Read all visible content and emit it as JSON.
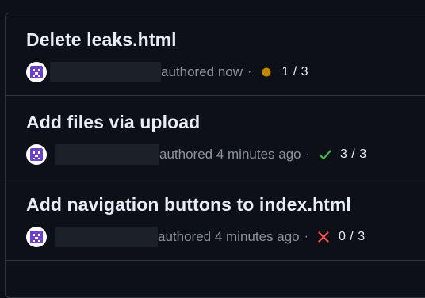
{
  "commits": [
    {
      "title": "Delete leaks.html",
      "authored": "authored now",
      "separator": "·",
      "status": "pending",
      "status_icon": "pending-dot-icon",
      "status_color": "#bf8700",
      "checks": "1 / 3"
    },
    {
      "title": "Add files via upload",
      "authored": "authored 4 minutes ago",
      "separator": "·",
      "status": "success",
      "status_icon": "check-icon",
      "status_color": "#3fb950",
      "checks": "3 / 3"
    },
    {
      "title": "Add navigation buttons to index.html",
      "authored": "authored 4 minutes ago",
      "separator": "·",
      "status": "failure",
      "status_icon": "x-icon",
      "status_color": "#f85149",
      "checks": "0 / 3"
    }
  ],
  "colors": {
    "background": "#0d1117",
    "border": "#30363d",
    "title": "#e6edf3",
    "muted": "#8b949e",
    "avatar": "#6e40c9"
  }
}
